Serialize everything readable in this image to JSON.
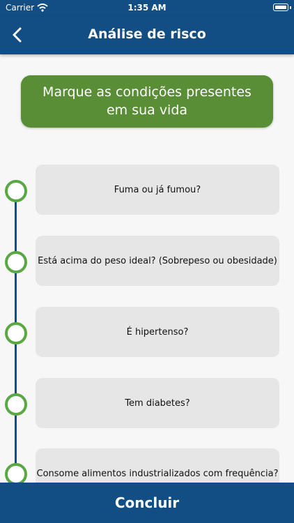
{
  "status_bar": {
    "carrier": "Carrier",
    "time": "1:35 AM"
  },
  "nav": {
    "title": "Análise de risco"
  },
  "header": {
    "text": "Marque as condições presentes em sua vida"
  },
  "options": [
    {
      "label": "Fuma ou já fumou?"
    },
    {
      "label": "Está acima do peso ideal? (Sobrepeso ou obesidade)"
    },
    {
      "label": "É hipertenso?"
    },
    {
      "label": "Tem diabetes?"
    },
    {
      "label": "Consome alimentos industrializados com frequência?"
    }
  ],
  "footer": {
    "button_label": "Concluir"
  },
  "colors": {
    "primary": "#124e84",
    "header_green": "#5a8e36",
    "dot_green": "#5aa843",
    "card_gray": "#e6e6e6"
  }
}
